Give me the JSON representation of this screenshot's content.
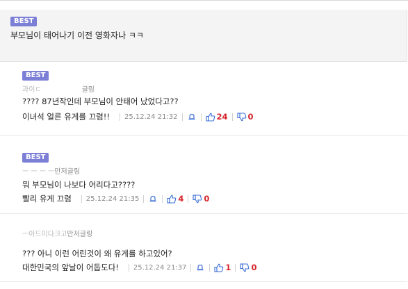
{
  "post": {
    "badge": "BEST",
    "text": "부모님이 태어나기 이전 영화자나 ㅋㅋ"
  },
  "replies": [
    {
      "badge": "BEST",
      "author_blurred": "과이ㄷ",
      "author_suffix": "글링",
      "line1": "???? 87년작인데 부모님이 안태어 났었다고??",
      "line2": "이녀석 얼른 유게를 끄렴!!",
      "date": "25.12.24 21:32",
      "up": "24",
      "down": "0"
    },
    {
      "badge": "BEST",
      "author_blurred": "ㅡ ㅡ ㅡ ㅡ",
      "author_suffix": "만저글링",
      "line1": "뭐 부모님이 나보다 어리다고????",
      "line2": "빨리 유게 끄렴",
      "date": "25.12.24 21:35",
      "up": "4",
      "down": "0"
    },
    {
      "badge": "",
      "author_blurred": "ㅡ아드이다크고",
      "author_suffix": "만저글링",
      "line1": "??? 아니 이런 어린것이 왜 유게를 하고있어?",
      "line2": "대한민국의 앞날이 어둡도다!",
      "date": "25.12.24 21:37",
      "up": "1",
      "down": "0"
    }
  ],
  "icons": {
    "report": "report-bell-icon",
    "up": "thumbs-up-icon",
    "down": "thumbs-down-icon"
  },
  "colors": {
    "badge": "#7b7fd6",
    "count": "#d6242a",
    "thumb": "#3b6fd6"
  }
}
